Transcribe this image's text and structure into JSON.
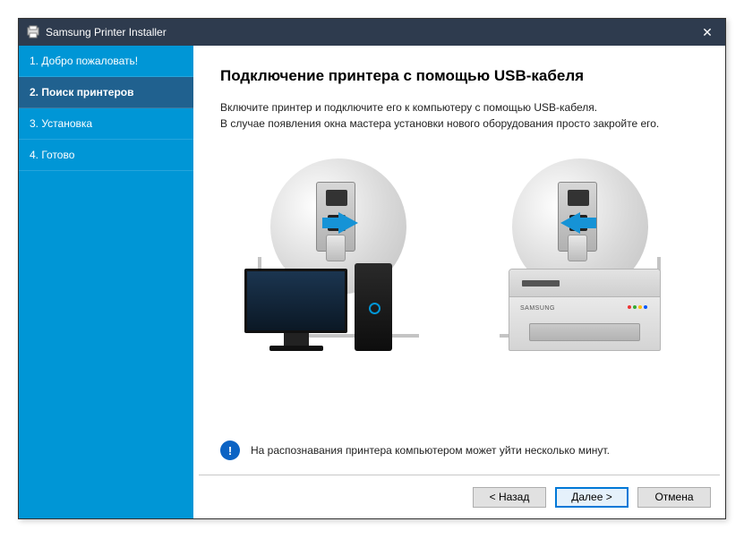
{
  "titlebar": {
    "title": "Samsung Printer Installer"
  },
  "sidebar": {
    "steps": [
      {
        "label": "1. Добро пожаловать!"
      },
      {
        "label": "2. Поиск принтеров"
      },
      {
        "label": "3. Установка"
      },
      {
        "label": "4. Готово"
      }
    ],
    "activeIndex": 1
  },
  "content": {
    "heading": "Подключение принтера с помощью USB-кабеля",
    "line1": "Включите принтер и подключите его к компьютеру с помощью USB-кабеля.",
    "line2": "В случае появления окна мастера установки нового оборудования просто закройте его.",
    "printerBrand": "SAMSUNG"
  },
  "note": {
    "icon": "!",
    "text": "На распознавания принтера компьютером может уйти несколько минут."
  },
  "buttons": {
    "back": "< Назад",
    "next": "Далее >",
    "cancel": "Отмена"
  },
  "colors": {
    "accent": "#0096d6",
    "titlebar": "#2e3b4e",
    "defaultButtonBorder": "#0078d7"
  }
}
